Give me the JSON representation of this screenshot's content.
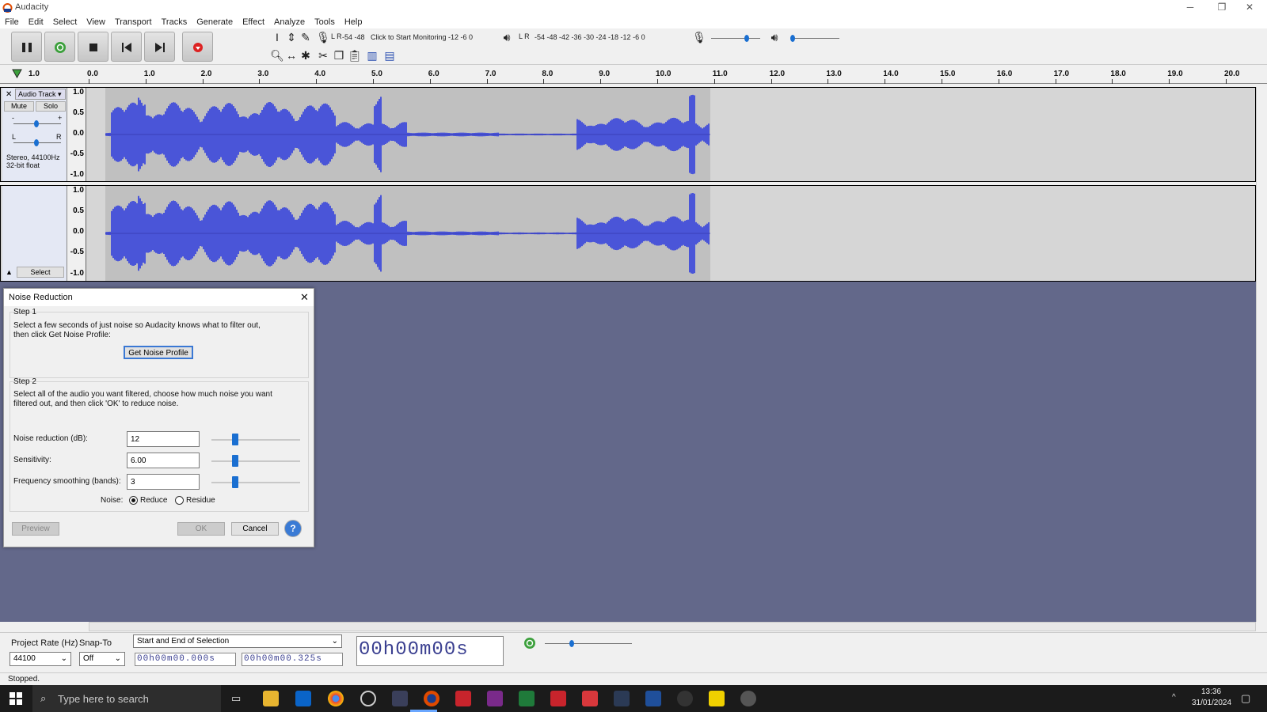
{
  "window": {
    "title": "Audacity",
    "min": "─",
    "restore": "❐",
    "close": "✕"
  },
  "menu": [
    "File",
    "Edit",
    "Select",
    "View",
    "Transport",
    "Tracks",
    "Generate",
    "Effect",
    "Analyze",
    "Tools",
    "Help"
  ],
  "meters": {
    "rec_scale_left": "-54 -48",
    "rec_prompt": "Click to Start Monitoring",
    "rec_scale_right": "-12 -6 0",
    "lr": "L R",
    "play_scale": "-54 -48 -42 -36 -30 -24 -18 -12 -6 0"
  },
  "ruler": {
    "start": "1.0",
    "ticks": [
      "0.0",
      "1.0",
      "2.0",
      "3.0",
      "4.0",
      "5.0",
      "6.0",
      "7.0",
      "8.0",
      "9.0",
      "10.0",
      "11.0",
      "12.0",
      "13.0",
      "14.0",
      "15.0",
      "16.0",
      "17.0",
      "18.0",
      "19.0",
      "20.0"
    ]
  },
  "track": {
    "name": "Audio Track",
    "mute": "Mute",
    "solo": "Solo",
    "minus": "-",
    "plus": "+",
    "left": "L",
    "right": "R",
    "info1": "Stereo, 44100Hz",
    "info2": "32-bit float",
    "select": "Select",
    "scale": [
      "1.0",
      "0.5",
      "0.0",
      "-0.5",
      "-1.0"
    ]
  },
  "dialog": {
    "title": "Noise Reduction",
    "step1": "Step 1",
    "step1_text1": "Select a few seconds of just noise so Audacity knows what to filter out,",
    "step1_text2": "then click Get Noise Profile:",
    "get_profile": "Get Noise Profile",
    "step2": "Step 2",
    "step2_text1": "Select all of the audio you want filtered, choose how much noise you want",
    "step2_text2": "filtered out, and then click 'OK' to reduce noise.",
    "nr_label": "Noise reduction (dB):",
    "nr_value": "12",
    "sens_label": "Sensitivity:",
    "sens_value": "6.00",
    "fs_label": "Frequency smoothing (bands):",
    "fs_value": "3",
    "noise_label": "Noise:",
    "reduce": "Reduce",
    "residue": "Residue",
    "preview": "Preview",
    "ok": "OK",
    "cancel": "Cancel",
    "help": "?"
  },
  "bottom": {
    "rate_label": "Project Rate (Hz)",
    "snap_label": "Snap-To",
    "sel_mode": "Start and End of Selection",
    "rate": "44100",
    "snap": "Off",
    "sel_start": "00h00m00.000s",
    "sel_end": "00h00m00.325s",
    "big_time": "00h00m00s",
    "status": "Stopped."
  },
  "taskbar": {
    "search": "Type here to search",
    "time": "13:36",
    "date": "31/01/2024"
  }
}
